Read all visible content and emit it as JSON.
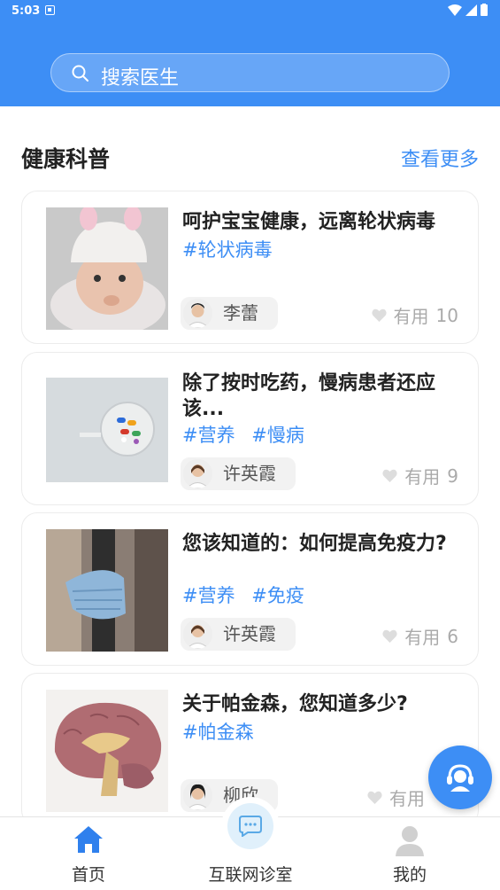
{
  "status": {
    "time": "5:03"
  },
  "search": {
    "placeholder": "搜索医生"
  },
  "section": {
    "title": "健康科普",
    "more": "查看更多"
  },
  "articles": [
    {
      "title": "呵护宝宝健康，远离轮状病毒",
      "tags": [
        "#轮状病毒"
      ],
      "author": "李蕾",
      "useful_label": "有用",
      "useful_count": "10"
    },
    {
      "title": "除了按时吃药，慢病患者还应该...",
      "tags": [
        "#营养",
        "#慢病"
      ],
      "author": "许英霞",
      "useful_label": "有用",
      "useful_count": "9"
    },
    {
      "title": " 您该知道的：如何提高免疫力?",
      "tags": [
        "#营养",
        "#免疫"
      ],
      "author": "许英霞",
      "useful_label": "有用",
      "useful_count": "6"
    },
    {
      "title": "关于帕金森，您知道多少?",
      "tags": [
        "#帕金森"
      ],
      "author": "柳欣",
      "useful_label": "有用",
      "useful_count": ""
    }
  ],
  "tabs": [
    {
      "label": "首页",
      "icon": "home-icon",
      "active": true
    },
    {
      "label": "互联网诊室",
      "icon": "chat-bubble-icon",
      "active": false
    },
    {
      "label": "我的",
      "icon": "user-icon",
      "active": false
    }
  ],
  "colors": {
    "primary": "#3d8ef5",
    "tag": "#3d8ef5",
    "muted": "#aaaaaa"
  }
}
